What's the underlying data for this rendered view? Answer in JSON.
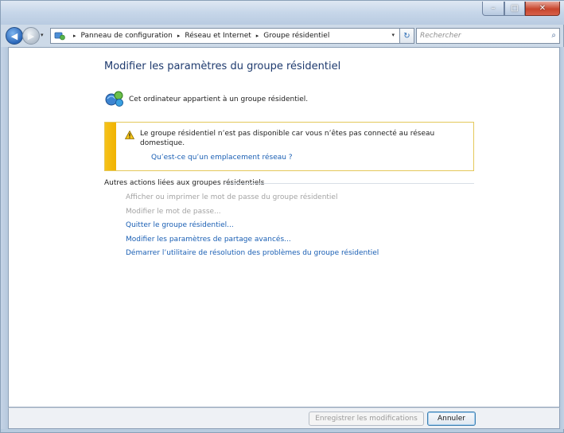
{
  "window": {
    "controls": {
      "minimize": "–",
      "maximize": "□",
      "close": "✕"
    }
  },
  "nav": {
    "back_icon": "arrow-left-icon",
    "forward_icon": "arrow-right-icon",
    "breadcrumb": [
      "Panneau de configuration",
      "Réseau et Internet",
      "Groupe résidentiel"
    ],
    "separator": "▸",
    "refresh_glyph": "↻",
    "search_placeholder": "Rechercher",
    "search_glyph": "⌕"
  },
  "page": {
    "title": "Modifier les paramètres du groupe résidentiel",
    "status": "Cet ordinateur appartient à un groupe résidentiel.",
    "warning": {
      "text": "Le groupe résidentiel n’est pas disponible car vous n’êtes pas connecté au réseau domestique.",
      "link": "Qu’est-ce qu’un emplacement réseau ?"
    },
    "other_actions_header": "Autres actions liées aux groupes résidentiels",
    "actions": [
      {
        "label": "Afficher ou imprimer le mot de passe du groupe résidentiel",
        "enabled": false
      },
      {
        "label": "Modifier le mot de passe...",
        "enabled": false
      },
      {
        "label": "Quitter le groupe résidentiel...",
        "enabled": true
      },
      {
        "label": "Modifier les paramètres de partage avancés...",
        "enabled": true
      },
      {
        "label": "Démarrer l’utilitaire de résolution des problèmes du groupe résidentiel",
        "enabled": true
      }
    ]
  },
  "footer": {
    "save_label": "Enregistrer les modifications",
    "cancel_label": "Annuler"
  },
  "colors": {
    "link": "#1a5fb4",
    "disabled": "#a3a3a3",
    "title": "#1e3a6e",
    "warning_stripe": "#f6c21a"
  }
}
